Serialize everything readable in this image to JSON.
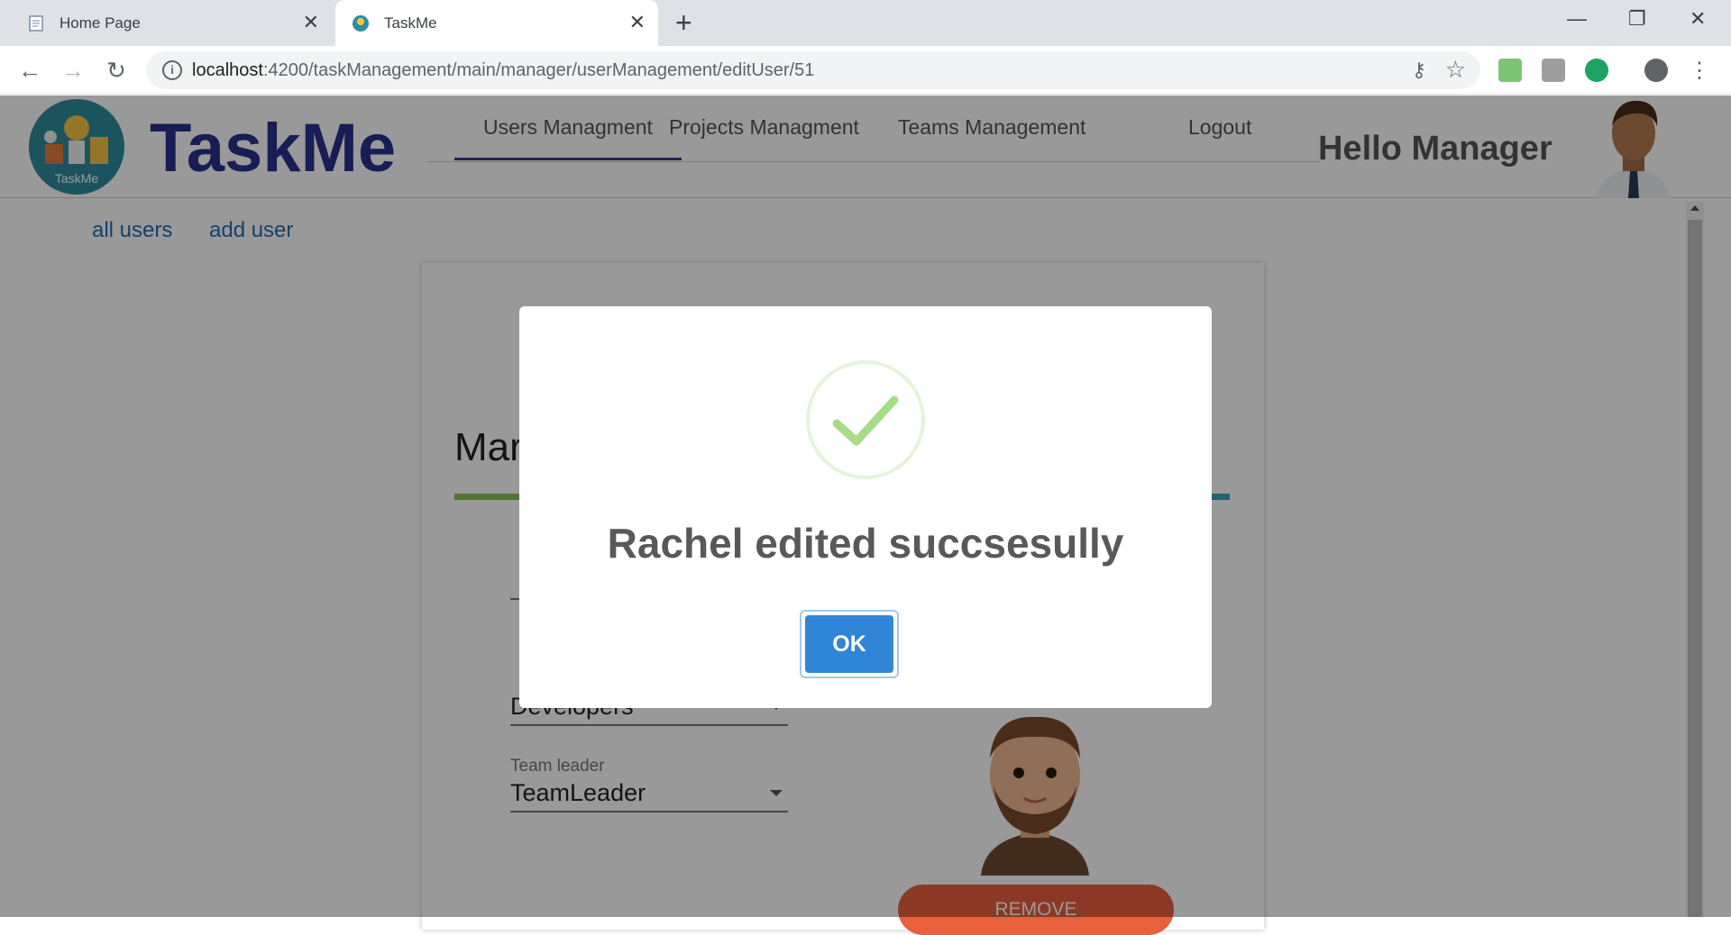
{
  "browser": {
    "tabs": [
      {
        "title": "Home Page",
        "active": false
      },
      {
        "title": "TaskMe",
        "active": true
      }
    ],
    "url_host": "localhost",
    "url_path": ":4200/taskManagement/main/manager/userManagement/editUser/51"
  },
  "header": {
    "brand": "TaskMe",
    "logo_text": "TaskMe",
    "nav": [
      "Users Managment",
      "Projects Managment",
      "Teams Management",
      "Logout"
    ],
    "active_nav": "Users Managment",
    "greeting": "Hello Manager"
  },
  "subnav": [
    "all users",
    "add user"
  ],
  "form": {
    "title_partial": "Mar",
    "department_value": "Developers",
    "team_leader_label": "Team leader",
    "team_leader_value": "TeamLeader",
    "remove_label": "REMOVE"
  },
  "dialog": {
    "message": "Rachel edited succsesully",
    "ok_label": "OK",
    "icon": "success-check-icon",
    "check_color": "#a5dc86",
    "button_color": "#3085d6"
  }
}
